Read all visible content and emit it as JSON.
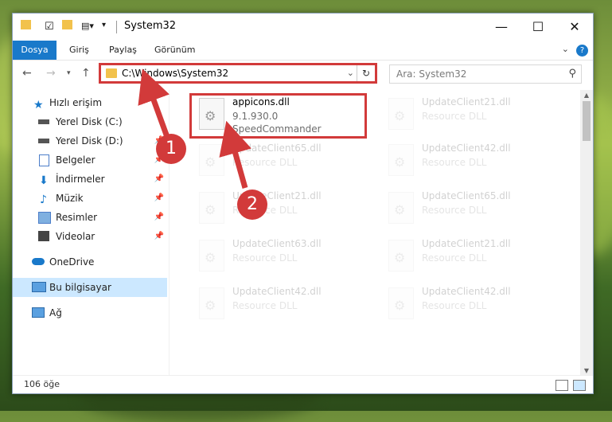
{
  "window": {
    "title": "System32",
    "minimize_icon": "minimize-icon",
    "maximize_icon": "maximize-icon",
    "close_icon": "close-icon"
  },
  "ribbon": {
    "tabs": [
      "Dosya",
      "Giriş",
      "Paylaş",
      "Görünüm"
    ],
    "accent": "#1979ca"
  },
  "address_bar": {
    "path": "C:\\Windows\\System32",
    "highlight_color": "#d23a3a"
  },
  "search": {
    "placeholder": "Ara: System32"
  },
  "sidebar": {
    "items": [
      {
        "label": "Hızlı erişim",
        "icon": "star-icon"
      },
      {
        "label": "Yerel Disk (C:)",
        "icon": "drive-icon",
        "pinned": false
      },
      {
        "label": "Yerel Disk (D:)",
        "icon": "drive-icon",
        "pinned": true
      },
      {
        "label": "Belgeler",
        "icon": "documents-icon",
        "pinned": true
      },
      {
        "label": "İndirmeler",
        "icon": "download-icon",
        "pinned": true
      },
      {
        "label": "Müzik",
        "icon": "music-icon",
        "pinned": true
      },
      {
        "label": "Resimler",
        "icon": "pictures-icon",
        "pinned": true
      },
      {
        "label": "Videolar",
        "icon": "videos-icon",
        "pinned": true
      },
      {
        "label": "OneDrive",
        "icon": "cloud-icon"
      },
      {
        "label": "Bu bilgisayar",
        "icon": "computer-icon",
        "selected": true
      },
      {
        "label": "Ağ",
        "icon": "network-icon"
      }
    ]
  },
  "files": {
    "highlighted": {
      "name": "appicons.dll",
      "version": "9.1.930.0",
      "company": "SpeedCommander"
    },
    "left_column": [
      {
        "name": "UpdateClient65.dll",
        "type": "Resource DLL"
      },
      {
        "name": "UpdateClient21.dll",
        "type": "Resource DLL"
      },
      {
        "name": "UpdateClient63.dll",
        "type": "Resource DLL"
      },
      {
        "name": "UpdateClient42.dll",
        "type": "Resource DLL"
      }
    ],
    "right_column": [
      {
        "name": "UpdateClient21.dll",
        "type": "Resource DLL"
      },
      {
        "name": "UpdateClient42.dll",
        "type": "Resource DLL"
      },
      {
        "name": "UpdateClient65.dll",
        "type": "Resource DLL"
      },
      {
        "name": "UpdateClient21.dll",
        "type": "Resource DLL"
      },
      {
        "name": "UpdateClient42.dll",
        "type": "Resource DLL"
      }
    ]
  },
  "status": {
    "item_count": "106 öğe"
  },
  "annotations": {
    "step1": "1",
    "step2": "2"
  }
}
